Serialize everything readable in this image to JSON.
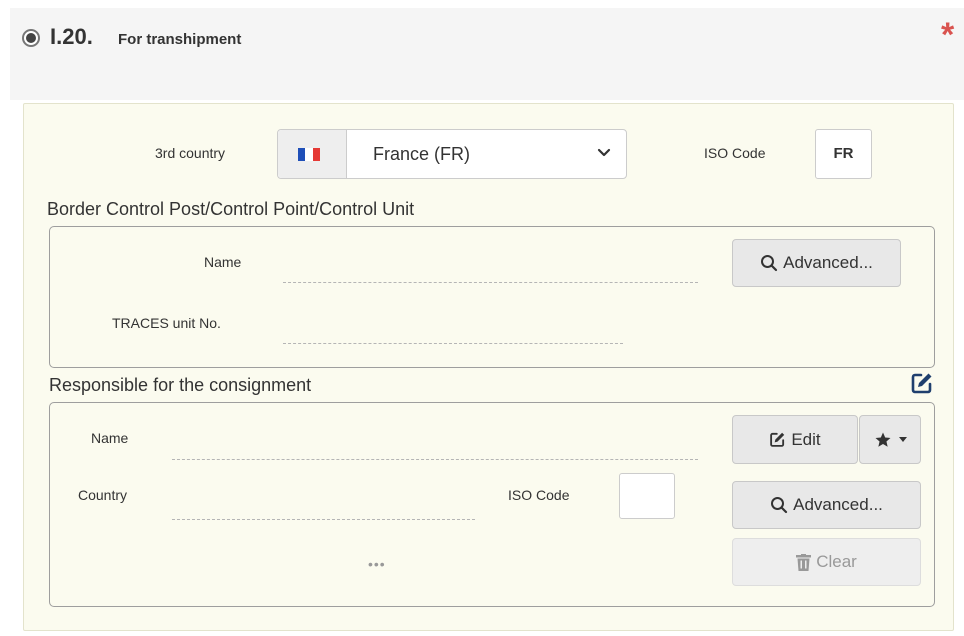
{
  "header": {
    "number": "I.20.",
    "title": "For transhipment",
    "required_mark": "*"
  },
  "third_country": {
    "label": "3rd country",
    "selected": "France (FR)",
    "flag_colors": [
      "#1f4fb8",
      "#ffffff",
      "#e53935"
    ],
    "iso_label": "ISO Code",
    "iso_value": "FR"
  },
  "bcp": {
    "title": "Border Control Post/Control Point/Control Unit",
    "name_label": "Name",
    "name_value": "",
    "traces_label": "TRACES unit No.",
    "traces_value": "",
    "advanced_label": "Advanced..."
  },
  "responsible": {
    "title": "Responsible for the consignment",
    "name_label": "Name",
    "name_value": "",
    "country_label": "Country",
    "country_value": "",
    "iso_label": "ISO Code",
    "iso_value": "",
    "more": "•••",
    "edit_label": "Edit",
    "advanced_label": "Advanced...",
    "clear_label": "Clear"
  },
  "colors": {
    "required": "#d9534f",
    "panel_bg": "#fbfbef",
    "icon_blue": "#1f3f6e"
  }
}
